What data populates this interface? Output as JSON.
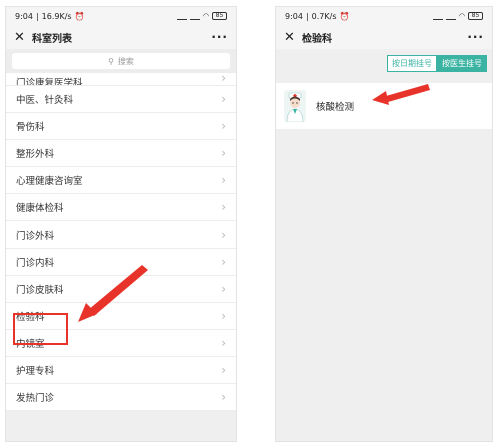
{
  "left": {
    "status": {
      "time": "9:04",
      "speed": "16.9K/s",
      "alarm_icon": "alarm-icon",
      "battery": "85"
    },
    "title": "科室列表",
    "search": {
      "placeholder": "搜索"
    },
    "departments": [
      "门诊康复医学科",
      "中医、针灸科",
      "骨伤科",
      "整形外科",
      "心理健康咨询室",
      "健康体检科",
      "门诊外科",
      "门诊内科",
      "门诊皮肤科",
      "检验科",
      "内镜室",
      "护理专科",
      "发热门诊"
    ]
  },
  "right": {
    "status": {
      "time": "9:04",
      "speed": "0.7K/s",
      "alarm_icon": "alarm-icon",
      "battery": "85"
    },
    "title": "检验科",
    "tabs": [
      "按日期挂号",
      "按医生挂号"
    ],
    "active_tab": "按医生挂号",
    "doctor": "核酸检测"
  },
  "colors": {
    "accent": "#3bb3a3",
    "highlight": "#e8332b"
  }
}
